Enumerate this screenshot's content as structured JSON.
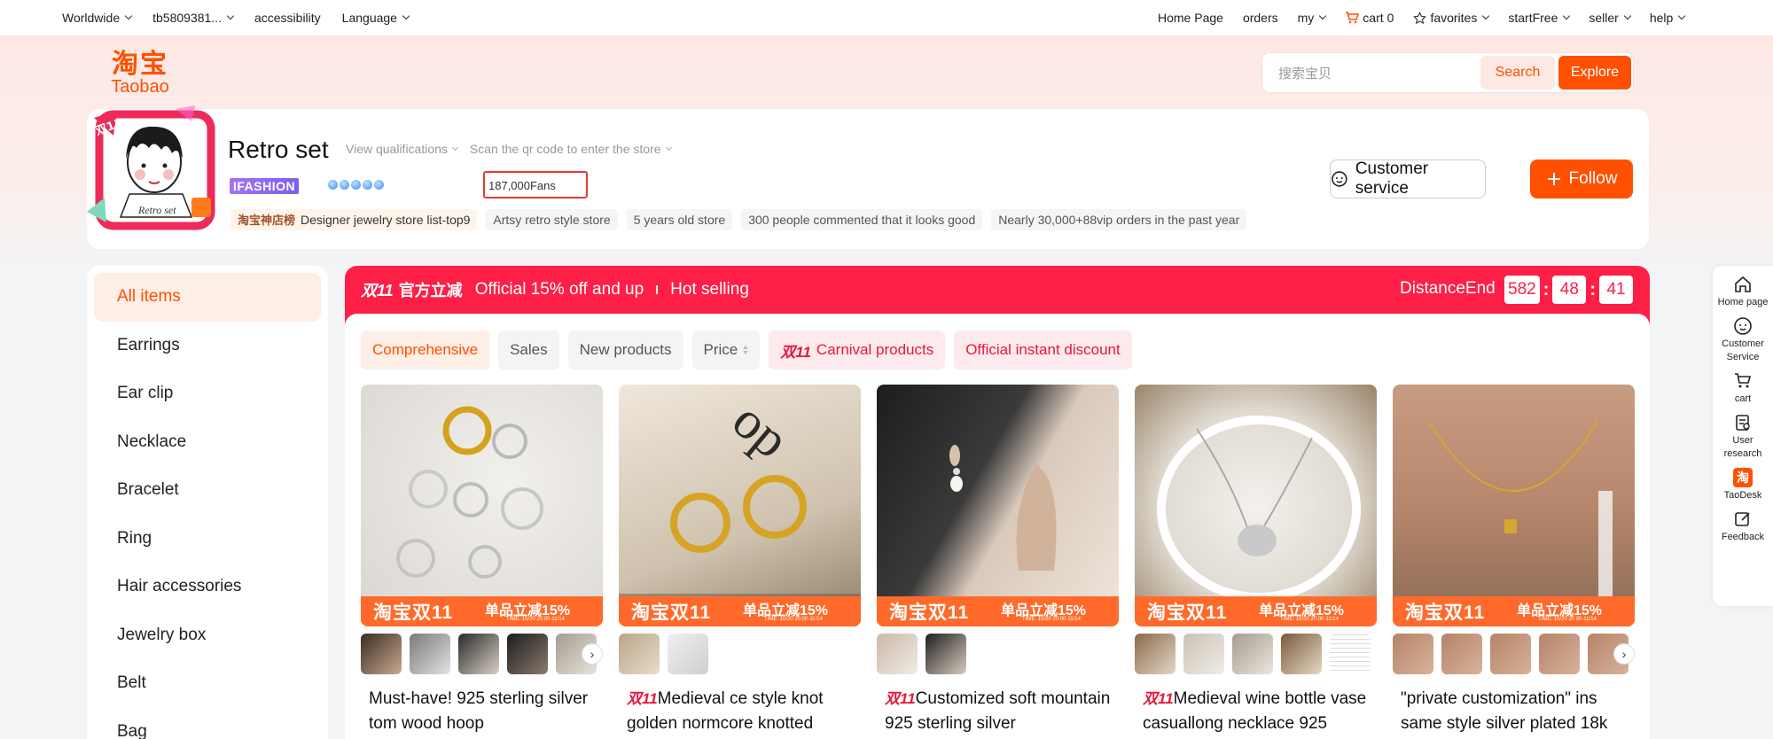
{
  "topbar": {
    "left": [
      "Worldwide",
      "tb5809381...",
      "accessibility",
      "Language"
    ],
    "home": "Home Page",
    "orders": "orders",
    "my": "my",
    "cart": "cart",
    "cart_count": "0",
    "favorites": "favorites",
    "startfree": "startFree",
    "seller": "seller",
    "help": "help"
  },
  "logo": {
    "cn": "淘宝",
    "en": "Taobao"
  },
  "search": {
    "placeholder": "搜索宝贝",
    "search_label": "Search",
    "explore_label": "Explore"
  },
  "shop": {
    "name": "Retro set",
    "view_qualifications": "View qualifications",
    "scan_qr": "Scan the qr code to enter the store",
    "brand": "IFASHION",
    "fans": "187,000Fans",
    "rank_prefix": "淘宝神店榜",
    "rank_text": "Designer jewelry store list-top9",
    "tags": [
      "Artsy retro style store",
      "5 years old store",
      "300 people commented that it looks good",
      "Nearly 30,000+88vip orders in the past year"
    ],
    "customer_service": "Customer service",
    "follow": "Follow",
    "avatar_text": "Retro set",
    "avatar_badge": "双11"
  },
  "sidebar": {
    "items": [
      {
        "label": "All items",
        "active": true
      },
      {
        "label": "Earrings"
      },
      {
        "label": "Ear clip"
      },
      {
        "label": "Necklace"
      },
      {
        "label": "Bracelet"
      },
      {
        "label": "Ring"
      },
      {
        "label": "Hair accessories"
      },
      {
        "label": "Jewelry box"
      },
      {
        "label": "Belt"
      },
      {
        "label": "Bag"
      }
    ]
  },
  "promo": {
    "d11": "双11",
    "gov": "官方立减",
    "off": "Official 15% off and up",
    "hot": "Hot selling",
    "distance": "DistanceEnd",
    "timer": [
      "582",
      "48",
      "41"
    ]
  },
  "filters": {
    "comprehensive": "Comprehensive",
    "sales": "Sales",
    "new": "New products",
    "price": "Price",
    "carnival_prefix": "双11",
    "carnival": "Carnival products",
    "instant": "Official instant discount"
  },
  "banner": {
    "left": "淘宝双11",
    "right": "单品立减15%",
    "time": "TIME: 10/20 20:00-11/14"
  },
  "products": [
    {
      "prefix": "",
      "title": "Must-have! 925 sterling silver tom wood hoop"
    },
    {
      "prefix": "双11",
      "title": "Medieval ce style knot golden normcore knotted"
    },
    {
      "prefix": "双11",
      "title": "Customized soft mountain 925 sterling silver"
    },
    {
      "prefix": "双11",
      "title": "Medieval wine bottle vase casuallong necklace 925"
    },
    {
      "prefix": "",
      "title": "\"private customization\" ins same style silver plated 18k"
    }
  ],
  "rail": {
    "home": "Home page",
    "customer": "Customer Service",
    "cart": "cart",
    "research": "User research",
    "taodesk_icon": "淘",
    "taodesk": "TaoDesk",
    "feedback": "Feedback"
  }
}
